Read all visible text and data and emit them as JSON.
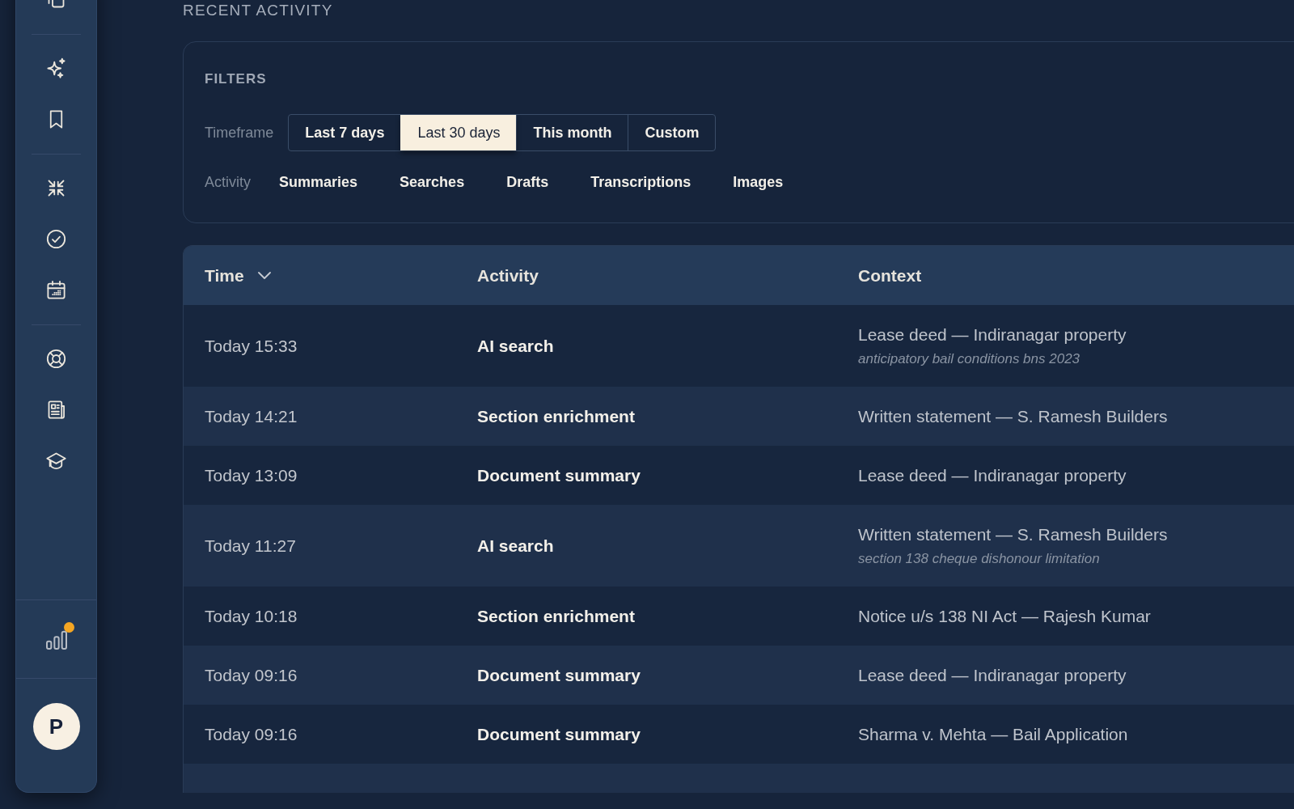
{
  "sidebar": {
    "stats_alert": true,
    "avatar_initial": "P"
  },
  "page_title": "RECENT ACTIVITY",
  "filters": {
    "title": "FILTERS",
    "timeframe": {
      "label": "Timeframe",
      "options": [
        {
          "label": "Last 7 days",
          "selected": false
        },
        {
          "label": "Last 30 days",
          "selected": true
        },
        {
          "label": "This month",
          "selected": false
        },
        {
          "label": "Custom",
          "selected": false
        }
      ]
    },
    "activity": {
      "label": "Activity",
      "options": [
        {
          "label": "Summaries",
          "selected": false
        },
        {
          "label": "Searches",
          "selected": false
        },
        {
          "label": "Drafts",
          "selected": false
        },
        {
          "label": "Transcriptions",
          "selected": false
        },
        {
          "label": "Images",
          "selected": false
        }
      ]
    }
  },
  "table": {
    "columns": [
      {
        "label": "Time",
        "sorted": true
      },
      {
        "label": "Activity",
        "sorted": false
      },
      {
        "label": "Context",
        "sorted": false
      }
    ],
    "rows": [
      {
        "time": "Today 15:33",
        "activity": "AI search",
        "context": "Lease deed — Indiranagar property",
        "query": "anticipatory bail conditions bns 2023"
      },
      {
        "time": "Today 14:21",
        "activity": "Section enrichment",
        "context": "Written statement — S. Ramesh Builders"
      },
      {
        "time": "Today 13:09",
        "activity": "Document summary",
        "context": "Lease deed — Indiranagar property"
      },
      {
        "time": "Today 11:27",
        "activity": "AI search",
        "context": "Written statement — S. Ramesh Builders",
        "query": "section 138 cheque dishonour limitation"
      },
      {
        "time": "Today 10:18",
        "activity": "Section enrichment",
        "context": "Notice u/s 138 NI Act — Rajesh Kumar"
      },
      {
        "time": "Today 09:16",
        "activity": "Document summary",
        "context": "Lease deed — Indiranagar property"
      },
      {
        "time": "Today 09:16",
        "activity": "Document summary",
        "context": "Sharma v. Mehta — Bail Application"
      }
    ]
  }
}
